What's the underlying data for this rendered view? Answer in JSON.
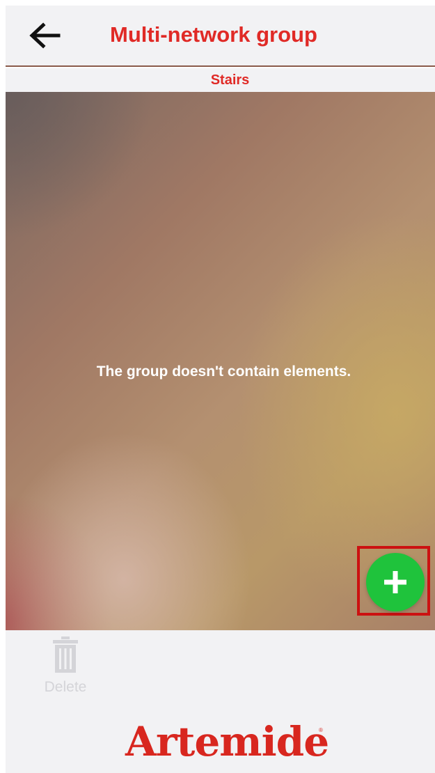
{
  "header": {
    "title": "Multi-network group",
    "back_icon": "arrow-left-icon"
  },
  "subtitle": "Stairs",
  "main": {
    "empty_message": "The group doesn't contain elements.",
    "add_icon": "plus-icon"
  },
  "toolbar": {
    "delete_label": "Delete",
    "delete_icon": "trash-icon"
  },
  "footer": {
    "brand": "Artemide"
  },
  "colors": {
    "accent_red": "#e02a26",
    "fab_green": "#1fc33c",
    "highlight_red": "#cc1111",
    "bar_background": "#f2f2f4"
  }
}
